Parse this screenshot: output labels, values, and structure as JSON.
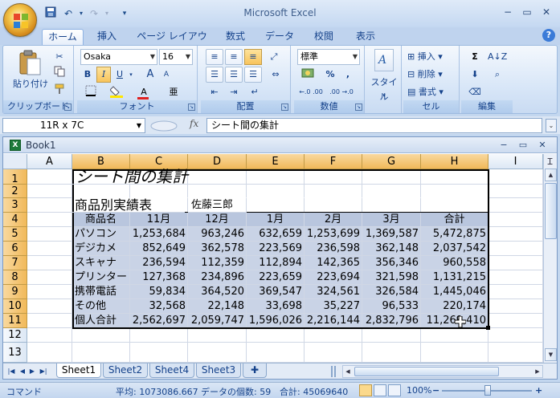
{
  "window": {
    "title": "Microsoft Excel",
    "minimize": "−",
    "restore": "▭",
    "close": "✕"
  },
  "quick_access": {
    "save_icon": "save-icon",
    "undo_icon": "undo-icon",
    "redo_icon": "redo-icon",
    "customize": "▾"
  },
  "tabs": [
    "ホーム",
    "挿入",
    "ページ レイアウト",
    "数式",
    "データ",
    "校閲",
    "表示"
  ],
  "active_tab": "ホーム",
  "help": "?",
  "ribbon": {
    "clipboard": {
      "label": "クリップボード",
      "paste": "貼り付け"
    },
    "font": {
      "label": "フォント",
      "font_name": "Osaka",
      "font_size": "16",
      "bold": "B",
      "italic": "I",
      "underline": "U",
      "grow": "A",
      "shrink": "A",
      "font_color": "A",
      "phonetic": "亜"
    },
    "alignment": {
      "label": "配置"
    },
    "number": {
      "label": "数値",
      "format": "標準",
      "percent": "%",
      "comma": ",",
      "inc_dec": "←.0 .00",
      "dec_dec": ".00 →.0"
    },
    "styles": {
      "label": "スタイル"
    },
    "cells": {
      "label": "セル",
      "insert": "挿入",
      "delete": "削除",
      "format": "書式"
    },
    "editing": {
      "label": "編集",
      "sum": "Σ"
    }
  },
  "formula_bar": {
    "name_box": "11R x 7C",
    "fx": "fx",
    "formula": "シート間の集計",
    "expand": "⌄"
  },
  "workbook": {
    "title": "Book1",
    "minimize": "−",
    "restore": "▭",
    "close": "✕",
    "columns": [
      "A",
      "B",
      "C",
      "D",
      "E",
      "F",
      "G",
      "H",
      "I"
    ],
    "rows": [
      "1",
      "2",
      "3",
      "4",
      "5",
      "6",
      "7",
      "8",
      "9",
      "10",
      "11",
      "12",
      "13"
    ],
    "cells": {
      "title": "シート間の集計",
      "subtitle": "商品別実績表",
      "author": "佐藤三郎",
      "headers": [
        "商品名",
        "11月",
        "12月",
        "1月",
        "2月",
        "3月",
        "合計"
      ],
      "rows": [
        [
          "パソコン",
          "1,253,684",
          "963,246",
          "632,659",
          "1,253,699",
          "1,369,587",
          "5,472,875"
        ],
        [
          "デジカメ",
          "852,649",
          "362,578",
          "223,569",
          "236,598",
          "362,148",
          "2,037,542"
        ],
        [
          "スキャナ",
          "236,594",
          "112,359",
          "112,894",
          "142,365",
          "356,346",
          "960,558"
        ],
        [
          "プリンター",
          "127,368",
          "234,896",
          "223,659",
          "223,694",
          "321,598",
          "1,131,215"
        ],
        [
          "携帯電話",
          "59,834",
          "364,520",
          "369,547",
          "324,561",
          "326,584",
          "1,445,046"
        ],
        [
          "その他",
          "32,568",
          "22,148",
          "33,698",
          "35,227",
          "96,533",
          "220,174"
        ],
        [
          "個人合計",
          "2,562,697",
          "2,059,747",
          "1,596,026",
          "2,216,144",
          "2,832,796",
          "11,269,410"
        ]
      ]
    },
    "sheet_tabs": [
      "Sheet1",
      "Sheet2",
      "Sheet4",
      "Sheet3"
    ],
    "active_sheet": "Sheet1"
  },
  "status_bar": {
    "mode": "コマンド",
    "average": "平均: 1073086.667",
    "count": "データの個数: 59",
    "sum": "合計: 45069640",
    "zoom": "100%",
    "zoom_out": "−",
    "zoom_in": "+"
  },
  "colors": {
    "ribbon_bg": "#d9e7f8",
    "selection": "#c9d3e6",
    "header_selected": "#f1b95a",
    "text_blue": "#15428b"
  }
}
